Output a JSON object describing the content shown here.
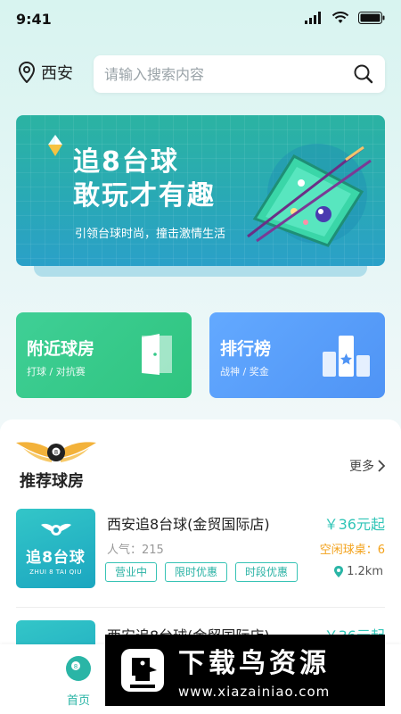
{
  "status": {
    "time": "9:41"
  },
  "location": {
    "city": "西安"
  },
  "search": {
    "placeholder": "请输入搜索内容"
  },
  "banner": {
    "title_line1": "追8台球",
    "title_line2": "敢玩才有趣",
    "subtitle": "引领台球时尚，撞击激情生活"
  },
  "entries": [
    {
      "title": "附近球房",
      "subtitle": "打球 / 对抗赛",
      "icon": "door-icon",
      "color": "#3fcf96"
    },
    {
      "title": "排行榜",
      "subtitle": "战神 / 奖金",
      "icon": "podium-icon",
      "color": "#5a9ff8"
    }
  ],
  "recommend": {
    "title": "推荐球房",
    "more_label": "更多"
  },
  "venues": [
    {
      "name": "西安追8台球(金贸国际店)",
      "price": "￥36元起",
      "popularity": "人气：215",
      "free_tables": "空闲球桌：6",
      "tags": [
        "营业中",
        "限时优惠",
        "时段优惠"
      ],
      "distance": "1.2km",
      "logo_name": "追8台球",
      "logo_pinyin": "ZHUI 8 TAI QIU"
    },
    {
      "name": "西安追8台球(金贸国际店)",
      "price": "￥36元起"
    }
  ],
  "tabbar": {
    "home_label": "首页"
  },
  "watermark": {
    "brand": "下载鸟资源",
    "url": "www.xiazainiao.com"
  },
  "colors": {
    "accent": "#2ab5a6",
    "price": "#31c5b7",
    "free": "#f3a21b"
  }
}
